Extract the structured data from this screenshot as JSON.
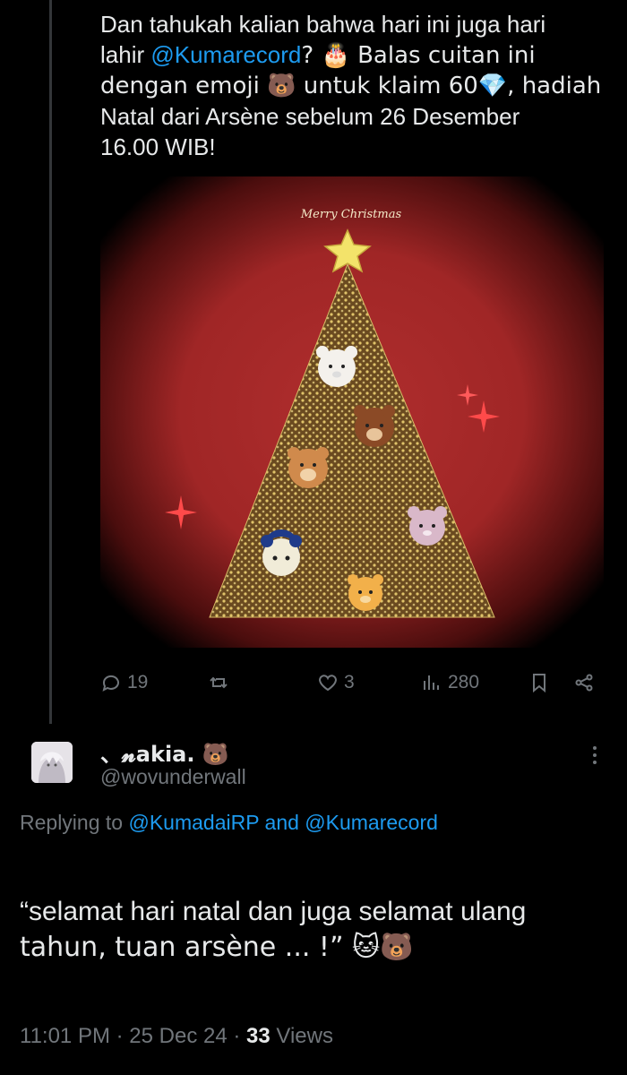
{
  "tweet": {
    "line1": "Dan tahukah kalian bahwa hari ini juga hari",
    "line2_pre": "lahir ",
    "line2_mention": "@Kumarecord",
    "line2_post": "? 🎂 Balas cuitan ini",
    "line3": "dengan emoji 🐻 untuk klaim 60💎, hadiah",
    "line4": "Natal dari Arsène  sebelum 26 Desember",
    "line5": "16.00 WIB!",
    "image_caption": "Merry Christmas",
    "stats": {
      "replies": "19",
      "retweets": "",
      "likes": "3",
      "views": "280"
    },
    "colors": {
      "accent": "#1d9bf0",
      "muted": "#71767b",
      "card_red": "#a52a2a"
    }
  },
  "reply": {
    "display_name": "、𝓷akia. 🐻",
    "handle": "@wovunderwall",
    "replying_prefix": "Replying to ",
    "replying_user1": "@KumadaiRP",
    "replying_and": " and ",
    "replying_user2": "@Kumarecord",
    "text_line1": "“selamat hari natal dan juga selamat ulang",
    "text_line2": "tahun, tuan arsène ... !” 🐱🐻",
    "time": "11:01 PM",
    "sep1": " · ",
    "date": "25 Dec 24",
    "sep2": " · ",
    "views_count": "33",
    "views_label": " Views"
  },
  "icons": {
    "reply": "comment-bubble-icon",
    "retweet": "retweet-icon",
    "like": "heart-icon",
    "views": "bar-chart-icon",
    "bookmark": "bookmark-icon",
    "share": "share-icon",
    "more": "more-vertical-icon"
  }
}
